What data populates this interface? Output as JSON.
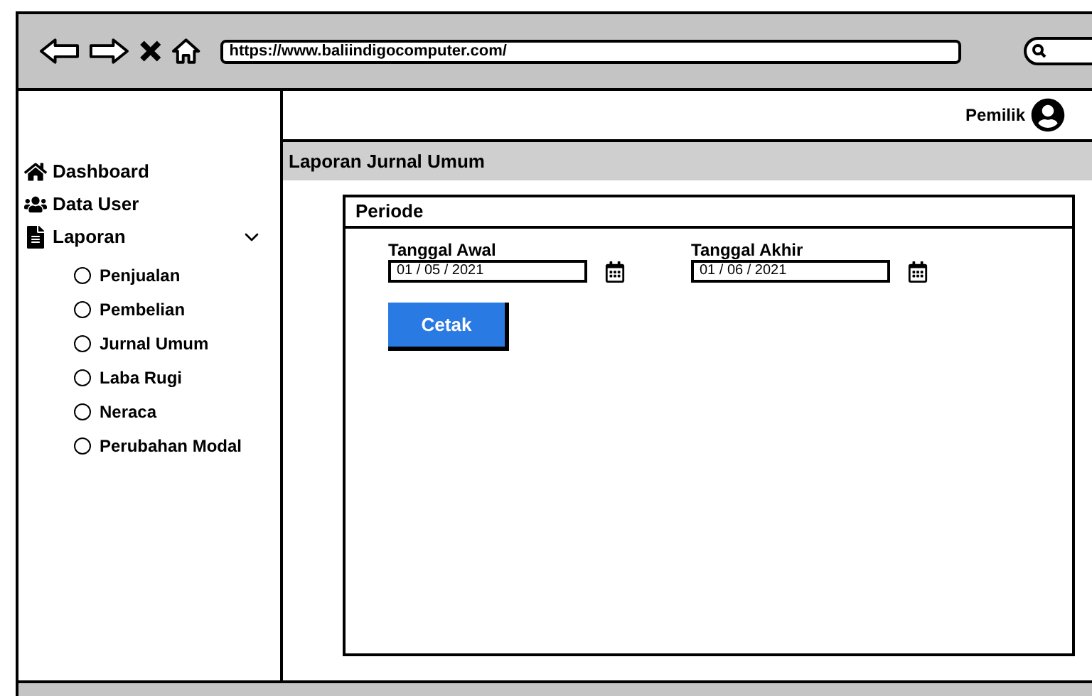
{
  "browser": {
    "url": "https://www.baliindigocomputer.com/"
  },
  "header": {
    "user": "Pemilik"
  },
  "sidebar": {
    "items": [
      {
        "kind": "link",
        "label": "Dashboard"
      },
      {
        "kind": "link",
        "label": "Data User"
      },
      {
        "kind": "group",
        "label": "Laporan",
        "expanded": true,
        "children": [
          {
            "label": "Penjualan",
            "selected": false
          },
          {
            "label": "Pembelian",
            "selected": false
          },
          {
            "label": "Jurnal Umum",
            "selected": false
          },
          {
            "label": "Laba Rugi",
            "selected": false
          },
          {
            "label": "Neraca",
            "selected": false
          },
          {
            "label": "Perubahan Modal",
            "selected": false
          }
        ]
      }
    ]
  },
  "page": {
    "title": "Laporan Jurnal Umum"
  },
  "panel": {
    "title": "Periode",
    "fields": [
      {
        "label": "Tanggal Awal",
        "value": "01 / 05 / 2021"
      },
      {
        "label": "Tanggal Akhir",
        "value": "01 / 06 / 2021"
      }
    ],
    "button": "Cetak"
  }
}
